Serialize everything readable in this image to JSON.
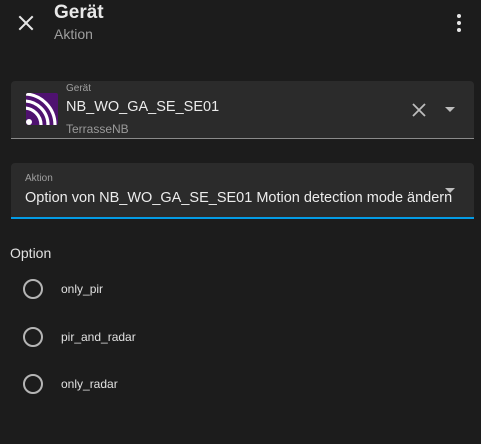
{
  "header": {
    "title": "Gerät",
    "subtitle": "Aktion"
  },
  "device_field": {
    "label": "Gerät",
    "device_name": "NB_WO_GA_SE_SE01",
    "area": "TerrasseNB",
    "icon_color": "#4f1270"
  },
  "action_field": {
    "label": "Aktion",
    "value": "Option von NB_WO_GA_SE_SE01 Motion detection mode ändern",
    "accent_color": "#039be5"
  },
  "options": {
    "heading": "Option",
    "items": [
      {
        "label": "only_pir",
        "selected": false
      },
      {
        "label": "pir_and_radar",
        "selected": false
      },
      {
        "label": "only_radar",
        "selected": false
      }
    ]
  }
}
